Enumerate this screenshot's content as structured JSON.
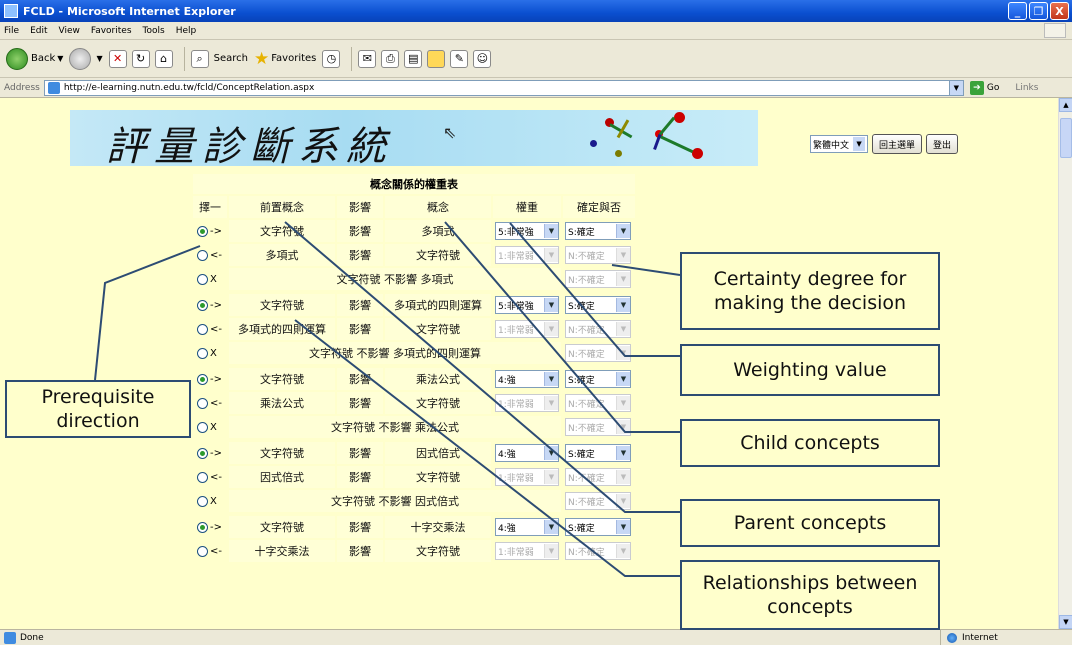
{
  "window": {
    "title": "FCLD - Microsoft Internet Explorer",
    "buttons": [
      "_",
      "❐",
      "X"
    ]
  },
  "menu": [
    "File",
    "Edit",
    "View",
    "Favorites",
    "Tools",
    "Help"
  ],
  "toolbar": {
    "back": "Back",
    "search": "Search",
    "favorites": "Favorites"
  },
  "address": {
    "label": "Address",
    "url": "http://e-learning.nutn.edu.tw/fcld/ConceptRelation.aspx",
    "go": "Go",
    "links": "Links"
  },
  "status": {
    "left": "Done",
    "zone": "Internet"
  },
  "banner": {
    "title": "評量診斷系統"
  },
  "controls": {
    "language": "繁體中文",
    "main_menu": "回主選單",
    "logout": "登出"
  },
  "table": {
    "title": "概念關係的權重表",
    "headers": [
      "擇一",
      "前置概念",
      "影響",
      "概念",
      "權重",
      "確定與否"
    ],
    "groups": [
      {
        "rows": [
          {
            "dir": "->",
            "selected": true,
            "pre": "文字符號",
            "rel": "影響",
            "concept": "多項式",
            "weight": "5:非常強",
            "certainty": "S:確定",
            "enabled": true
          },
          {
            "dir": "<-",
            "selected": false,
            "pre": "多項式",
            "rel": "影響",
            "concept": "文字符號",
            "weight": "1:非常弱",
            "certainty": "N:不確定",
            "enabled": false
          }
        ],
        "none_label": "X",
        "none_text": "文字符號 不影響 多項式",
        "none_certainty": "N:不確定"
      },
      {
        "rows": [
          {
            "dir": "->",
            "selected": true,
            "pre": "文字符號",
            "rel": "影響",
            "concept": "多項式的四則運算",
            "weight": "5:非常強",
            "certainty": "S:確定",
            "enabled": true
          },
          {
            "dir": "<-",
            "selected": false,
            "pre": "多項式的四則運算",
            "rel": "影響",
            "concept": "文字符號",
            "weight": "1:非常弱",
            "certainty": "N:不確定",
            "enabled": false
          }
        ],
        "none_label": "X",
        "none_text": "文字符號 不影響 多項式的四則運算",
        "none_certainty": "N:不確定"
      },
      {
        "rows": [
          {
            "dir": "->",
            "selected": true,
            "pre": "文字符號",
            "rel": "影響",
            "concept": "乘法公式",
            "weight": "4:強",
            "certainty": "S:確定",
            "enabled": true
          },
          {
            "dir": "<-",
            "selected": false,
            "pre": "乘法公式",
            "rel": "影響",
            "concept": "文字符號",
            "weight": "1:非常弱",
            "certainty": "N:不確定",
            "enabled": false
          }
        ],
        "none_label": "X",
        "none_text": "文字符號 不影響 乘法公式",
        "none_certainty": "N:不確定"
      },
      {
        "rows": [
          {
            "dir": "->",
            "selected": true,
            "pre": "文字符號",
            "rel": "影響",
            "concept": "因式倍式",
            "weight": "4:強",
            "certainty": "S:確定",
            "enabled": true
          },
          {
            "dir": "<-",
            "selected": false,
            "pre": "因式倍式",
            "rel": "影響",
            "concept": "文字符號",
            "weight": "1:非常弱",
            "certainty": "N:不確定",
            "enabled": false
          }
        ],
        "none_label": "X",
        "none_text": "文字符號 不影響 因式倍式",
        "none_certainty": "N:不確定"
      },
      {
        "rows": [
          {
            "dir": "->",
            "selected": true,
            "pre": "文字符號",
            "rel": "影響",
            "concept": "十字交乘法",
            "weight": "4:強",
            "certainty": "S:確定",
            "enabled": true
          },
          {
            "dir": "<-",
            "selected": false,
            "pre": "十字交乘法",
            "rel": "影響",
            "concept": "文字符號",
            "weight": "1:非常弱",
            "certainty": "N:不確定",
            "enabled": false
          }
        ]
      }
    ]
  },
  "annotations": {
    "prerequisite": "Prerequisite direction",
    "certainty": "Certainty degree for making the decision",
    "weighting": "Weighting value",
    "child": "Child concepts",
    "parent": "Parent concepts",
    "relationships": "Relationships between concepts"
  },
  "colors": {
    "page_bg": "#ffffcc",
    "callout_border": "#2d4c73"
  }
}
